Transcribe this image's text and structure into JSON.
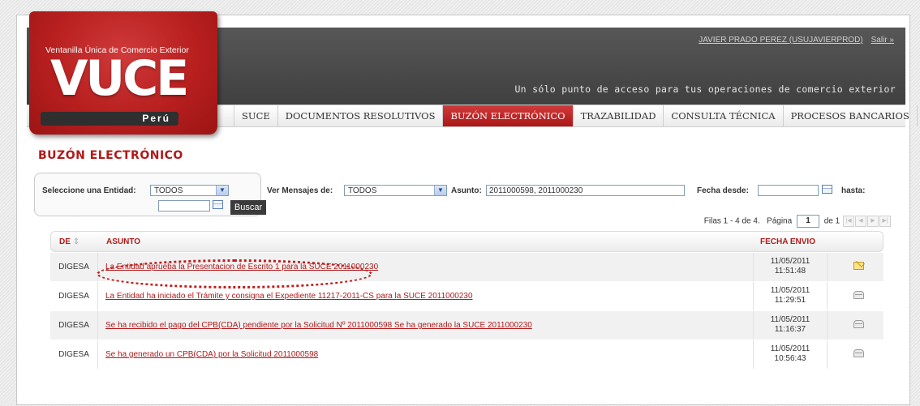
{
  "header": {
    "user": "JAVIER PRADO PEREZ (USUJAVIERPROD)",
    "logout": "Salir »",
    "tagline": "Un sólo punto de acceso para tus operaciones de comercio exterior"
  },
  "logo": {
    "caption": "Ventanilla Única de Comercio Exterior",
    "word": "VUCE",
    "country": "Perú"
  },
  "nav": {
    "items": [
      "SUCE",
      "DOCUMENTOS RESOLUTIVOS",
      "BUZÓN ELECTRÓNICO",
      "TRAZABILIDAD",
      "CONSULTA TÉCNICA",
      "PROCESOS BANCARIOS"
    ],
    "active_index": 2
  },
  "page_title": "BUZÓN ELECTRÓNICO",
  "filters": {
    "entidad_label": "Seleccione una Entidad:",
    "entidad_value": "TODOS",
    "ver_label": "Ver Mensajes de:",
    "ver_value": "TODOS",
    "asunto_label": "Asunto:",
    "asunto_value": "2011000598, 2011000230",
    "fecha_desde_label": "Fecha desde:",
    "fecha_desde_value": "",
    "hasta_label": "hasta:",
    "hasta_value": "",
    "search_button": "Buscar"
  },
  "pager": {
    "rows_text": "Filas 1 - 4 de 4.",
    "page_label": "Página",
    "page_value": "1",
    "of_text": "de 1"
  },
  "table": {
    "headers": {
      "de": "DE",
      "asunto": "ASUNTO",
      "fecha": "FECHA ENVIO"
    },
    "rows": [
      {
        "de": "DIGESA",
        "asunto": "La Entidad aprueba la Presentacion de Escrito 1 para la SUCE 2011000230",
        "fecha": "11/05/2011",
        "hora": "11:51:48",
        "icon": "unread-envelope-icon"
      },
      {
        "de": "DIGESA",
        "asunto": "La Entidad ha iniciado el Trámite y consigna el Expediente 11217-2011-CS para la SUCE 2011000230",
        "fecha": "11/05/2011",
        "hora": "11:29:51",
        "icon": "read-envelope-icon"
      },
      {
        "de": "DIGESA",
        "asunto": "Se ha recibido el pago del CPB(CDA) pendiente por la Solicitud Nº 2011000598 Se ha generado la SUCE 2011000230",
        "fecha": "11/05/2011",
        "hora": "11:16:37",
        "icon": "read-envelope-icon"
      },
      {
        "de": "DIGESA",
        "asunto": "Se ha generado un CPB(CDA) por la Solicitud 2011000598",
        "fecha": "11/05/2011",
        "hora": "10:56:43",
        "icon": "read-envelope-icon"
      }
    ]
  }
}
